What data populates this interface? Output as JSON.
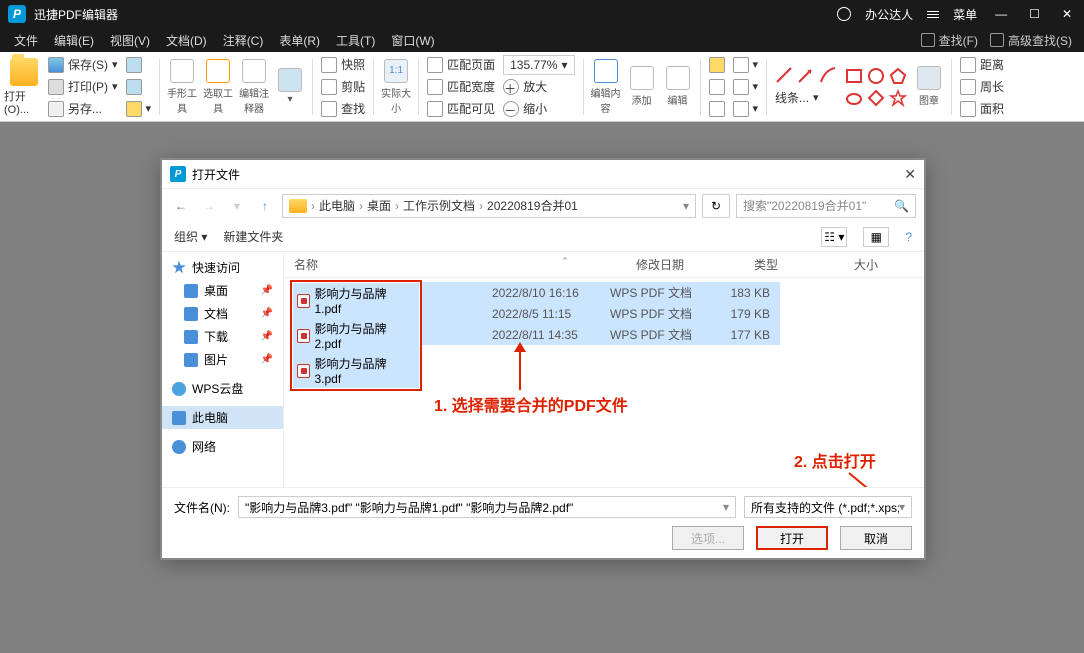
{
  "titlebar": {
    "app_name": "迅捷PDF编辑器",
    "user": "办公达人",
    "menu_label": "菜单"
  },
  "menus": [
    "文件",
    "编辑(E)",
    "视图(V)",
    "文档(D)",
    "注释(C)",
    "表单(R)",
    "工具(T)",
    "窗口(W)"
  ],
  "finders": {
    "find": "查找(F)",
    "adv": "高级查找(S)"
  },
  "toolbar": {
    "open": "打开(O)...",
    "save": "保存(S)",
    "print": "打印(P)",
    "other": "另存...",
    "hand": "手形工具",
    "select": "选取工具",
    "annot": "编辑注释器",
    "paste_group": {
      "snap": "快照",
      "clip": "剪贴",
      "find2": "查找"
    },
    "actual": "实际大小",
    "fit_page": "匹配页面",
    "fit_width": "匹配宽度",
    "fit_visible": "匹配可见",
    "zoom_pct": "135.77%",
    "zoom_in": "放大",
    "zoom_out": "缩小",
    "edit_content": "编辑内容",
    "add": "添加",
    "edit2": "编辑",
    "line": "线条...",
    "shapes": "图章",
    "dist": "距离",
    "perim": "周长",
    "area": "面积"
  },
  "dialog": {
    "title": "打开文件",
    "breadcrumb": [
      "此电脑",
      "桌面",
      "工作示例文档",
      "20220819合并01"
    ],
    "search_placeholder": "搜索\"20220819合并01\"",
    "org": "组织",
    "new_folder": "新建文件夹",
    "columns": [
      "名称",
      "修改日期",
      "类型",
      "大小"
    ],
    "sidebar": [
      {
        "label": "快速访问",
        "icon": "star"
      },
      {
        "label": "桌面",
        "icon": "desktop",
        "pinned": true
      },
      {
        "label": "文档",
        "icon": "doc",
        "pinned": true
      },
      {
        "label": "下载",
        "icon": "down",
        "pinned": true
      },
      {
        "label": "图片",
        "icon": "pic",
        "pinned": true
      },
      {
        "label": "WPS云盘",
        "icon": "cloud"
      },
      {
        "label": "此电脑",
        "icon": "pc",
        "active": true
      },
      {
        "label": "网络",
        "icon": "net"
      }
    ],
    "files": [
      {
        "name": "影响力与品牌1.pdf",
        "date": "2022/8/10 16:16",
        "type": "WPS PDF 文档",
        "size": "183 KB"
      },
      {
        "name": "影响力与品牌2.pdf",
        "date": "2022/8/5 11:15",
        "type": "WPS PDF 文档",
        "size": "179 KB"
      },
      {
        "name": "影响力与品牌3.pdf",
        "date": "2022/8/11 14:35",
        "type": "WPS PDF 文档",
        "size": "177 KB"
      }
    ],
    "filename_label": "文件名(N):",
    "filename_value": "\"影响力与品牌3.pdf\" \"影响力与品牌1.pdf\" \"影响力与品牌2.pdf\"",
    "filter": "所有支持的文件 (*.pdf;*.xps;*.)",
    "btn_select": "选项...",
    "btn_open": "打开",
    "btn_cancel": "取消"
  },
  "annotations": {
    "step1": "1. 选择需要合并的PDF文件",
    "step2": "2. 点击打开"
  }
}
